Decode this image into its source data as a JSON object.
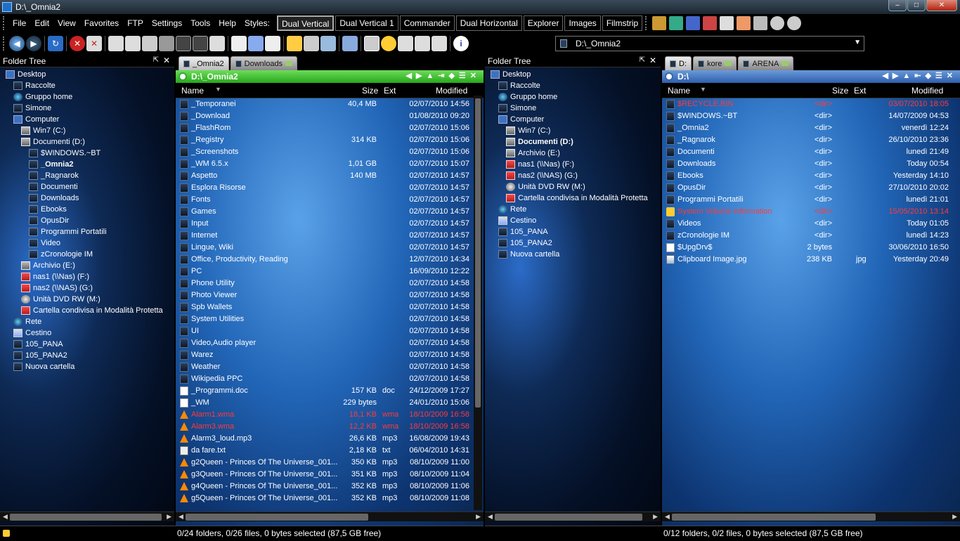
{
  "window": {
    "title": "D:\\_Omnia2",
    "min": "–",
    "max": "□",
    "close": "✕"
  },
  "menu": [
    "File",
    "Edit",
    "View",
    "Favorites",
    "FTP",
    "Settings",
    "Tools",
    "Help",
    "Styles:"
  ],
  "styles": [
    {
      "label": "Dual Vertical",
      "active": true
    },
    {
      "label": "Dual Vertical 1",
      "active": false
    },
    {
      "label": "Commander",
      "active": false
    },
    {
      "label": "Dual Horizontal",
      "active": false
    },
    {
      "label": "Explorer",
      "active": false
    },
    {
      "label": "Images",
      "active": false
    },
    {
      "label": "Filmstrip",
      "active": false
    }
  ],
  "colors": {
    "red_file": "#ff3a3a",
    "path_green": "#27a81c",
    "path_blue": "#2e5fae"
  },
  "address": {
    "value": "D:\\_Omnia2"
  },
  "left_tree": {
    "title": "Folder Tree",
    "nodes": [
      {
        "label": "Desktop",
        "indent": 0,
        "icon": "desktop-icon"
      },
      {
        "label": "Raccolte",
        "indent": 1,
        "icon": "folder-icon"
      },
      {
        "label": "Gruppo home",
        "indent": 1,
        "icon": "network-icon"
      },
      {
        "label": "Simone",
        "indent": 1,
        "icon": "folder-icon"
      },
      {
        "label": "Computer",
        "indent": 1,
        "icon": "computer-icon"
      },
      {
        "label": "Win7 (C:)",
        "indent": 2,
        "icon": "drive-icon"
      },
      {
        "label": "Documenti (D:)",
        "indent": 2,
        "icon": "drive-icon"
      },
      {
        "label": "$WINDOWS.~BT",
        "indent": 3,
        "icon": "folder-icon"
      },
      {
        "label": "_Omnia2",
        "indent": 3,
        "icon": "folder-icon",
        "selected": true
      },
      {
        "label": "_Ragnarok",
        "indent": 3,
        "icon": "folder-icon"
      },
      {
        "label": "Documenti",
        "indent": 3,
        "icon": "folder-icon"
      },
      {
        "label": "Downloads",
        "indent": 3,
        "icon": "folder-icon"
      },
      {
        "label": "Ebooks",
        "indent": 3,
        "icon": "folder-icon"
      },
      {
        "label": "OpusDir",
        "indent": 3,
        "icon": "folder-icon"
      },
      {
        "label": "Programmi Portatili",
        "indent": 3,
        "icon": "folder-icon"
      },
      {
        "label": "Video",
        "indent": 3,
        "icon": "folder-icon"
      },
      {
        "label": "zCronologie IM",
        "indent": 3,
        "icon": "folder-icon"
      },
      {
        "label": "Archivio (E:)",
        "indent": 2,
        "icon": "drive-icon"
      },
      {
        "label": "nas1 (\\\\Nas) (F:)",
        "indent": 2,
        "icon": "network-drive-icon"
      },
      {
        "label": "nas2 (\\\\NAS) (G:)",
        "indent": 2,
        "icon": "network-drive-icon"
      },
      {
        "label": "Unità DVD RW (M:)",
        "indent": 2,
        "icon": "dvd-icon"
      },
      {
        "label": "Cartella condivisa in Modalità Protetta",
        "indent": 2,
        "icon": "shared-folder-icon"
      },
      {
        "label": "Rete",
        "indent": 1,
        "icon": "network-icon"
      },
      {
        "label": "Cestino",
        "indent": 1,
        "icon": "recycle-bin-icon"
      },
      {
        "label": "105_PANA",
        "indent": 1,
        "icon": "folder-icon"
      },
      {
        "label": "105_PANA2",
        "indent": 1,
        "icon": "folder-icon"
      },
      {
        "label": "Nuova cartella",
        "indent": 1,
        "icon": "folder-icon"
      }
    ]
  },
  "right_tree": {
    "title": "Folder Tree",
    "nodes": [
      {
        "label": "Desktop",
        "indent": 0,
        "icon": "desktop-icon"
      },
      {
        "label": "Raccolte",
        "indent": 1,
        "icon": "folder-icon"
      },
      {
        "label": "Gruppo home",
        "indent": 1,
        "icon": "network-icon"
      },
      {
        "label": "Simone",
        "indent": 1,
        "icon": "folder-icon"
      },
      {
        "label": "Computer",
        "indent": 1,
        "icon": "computer-icon"
      },
      {
        "label": "Win7 (C:)",
        "indent": 2,
        "icon": "drive-icon"
      },
      {
        "label": "Documenti (D:)",
        "indent": 2,
        "icon": "drive-icon",
        "selected": true
      },
      {
        "label": "Archivio (E:)",
        "indent": 2,
        "icon": "drive-icon"
      },
      {
        "label": "nas1 (\\\\Nas) (F:)",
        "indent": 2,
        "icon": "network-drive-icon"
      },
      {
        "label": "nas2 (\\\\NAS) (G:)",
        "indent": 2,
        "icon": "network-drive-icon"
      },
      {
        "label": "Unità DVD RW (M:)",
        "indent": 2,
        "icon": "dvd-icon"
      },
      {
        "label": "Cartella condivisa in Modalità Protetta",
        "indent": 2,
        "icon": "shared-folder-icon"
      },
      {
        "label": "Rete",
        "indent": 1,
        "icon": "network-icon"
      },
      {
        "label": "Cestino",
        "indent": 1,
        "icon": "recycle-bin-icon"
      },
      {
        "label": "105_PANA",
        "indent": 1,
        "icon": "folder-icon"
      },
      {
        "label": "105_PANA2",
        "indent": 1,
        "icon": "folder-icon"
      },
      {
        "label": "Nuova cartella",
        "indent": 1,
        "icon": "folder-icon"
      }
    ]
  },
  "left_files": {
    "tabs": [
      {
        "label": "_Omnia2",
        "active": true
      },
      {
        "label": "Downloads",
        "active": false
      }
    ],
    "path": "D:\\_Omnia2",
    "columns": {
      "name": "Name",
      "size": "Size",
      "ext": "Ext",
      "modified": "Modified"
    },
    "rows": [
      {
        "name": "_Temporanei",
        "size": "40,4 MB",
        "ext": "",
        "modified": "02/07/2010 14:56",
        "type": "folder"
      },
      {
        "name": "_Download",
        "size": "",
        "ext": "",
        "modified": "01/08/2010 09:20",
        "type": "folder"
      },
      {
        "name": "_FlashRom",
        "size": "",
        "ext": "",
        "modified": "02/07/2010 15:06",
        "type": "folder"
      },
      {
        "name": "_Registry",
        "size": "314 KB",
        "ext": "",
        "modified": "02/07/2010 15:06",
        "type": "folder"
      },
      {
        "name": "_Screenshots",
        "size": "",
        "ext": "",
        "modified": "02/07/2010 15:06",
        "type": "folder"
      },
      {
        "name": "_WM 6.5.x",
        "size": "1,01 GB",
        "ext": "",
        "modified": "02/07/2010 15:07",
        "type": "folder"
      },
      {
        "name": "Aspetto",
        "size": "140 MB",
        "ext": "",
        "modified": "02/07/2010 14:57",
        "type": "folder"
      },
      {
        "name": "Esplora Risorse",
        "size": "",
        "ext": "",
        "modified": "02/07/2010 14:57",
        "type": "folder"
      },
      {
        "name": "Fonts",
        "size": "",
        "ext": "",
        "modified": "02/07/2010 14:57",
        "type": "folder"
      },
      {
        "name": "Games",
        "size": "",
        "ext": "",
        "modified": "02/07/2010 14:57",
        "type": "folder"
      },
      {
        "name": "Input",
        "size": "",
        "ext": "",
        "modified": "02/07/2010 14:57",
        "type": "folder"
      },
      {
        "name": "Internet",
        "size": "",
        "ext": "",
        "modified": "02/07/2010 14:57",
        "type": "folder"
      },
      {
        "name": "Lingue, Wiki",
        "size": "",
        "ext": "",
        "modified": "02/07/2010 14:57",
        "type": "folder"
      },
      {
        "name": "Office, Productivity, Reading",
        "size": "",
        "ext": "",
        "modified": "12/07/2010 14:34",
        "type": "folder"
      },
      {
        "name": "PC",
        "size": "",
        "ext": "",
        "modified": "16/09/2010 12:22",
        "type": "folder"
      },
      {
        "name": "Phone Utility",
        "size": "",
        "ext": "",
        "modified": "02/07/2010 14:58",
        "type": "folder"
      },
      {
        "name": "Photo Viewer",
        "size": "",
        "ext": "",
        "modified": "02/07/2010 14:58",
        "type": "folder"
      },
      {
        "name": "Spb Wallets",
        "size": "",
        "ext": "",
        "modified": "02/07/2010 14:58",
        "type": "folder"
      },
      {
        "name": "System Utilities",
        "size": "",
        "ext": "",
        "modified": "02/07/2010 14:58",
        "type": "folder"
      },
      {
        "name": "UI",
        "size": "",
        "ext": "",
        "modified": "02/07/2010 14:58",
        "type": "folder"
      },
      {
        "name": "Video,Audio player",
        "size": "",
        "ext": "",
        "modified": "02/07/2010 14:58",
        "type": "folder"
      },
      {
        "name": "Warez",
        "size": "",
        "ext": "",
        "modified": "02/07/2010 14:58",
        "type": "folder"
      },
      {
        "name": "Weather",
        "size": "",
        "ext": "",
        "modified": "02/07/2010 14:58",
        "type": "folder"
      },
      {
        "name": "Wikipedia PPC",
        "size": "",
        "ext": "",
        "modified": "02/07/2010 14:58",
        "type": "folder"
      },
      {
        "name": "_Programmi.doc",
        "size": "157 KB",
        "ext": "doc",
        "modified": "24/12/2009 17:27",
        "type": "file"
      },
      {
        "name": "_WM",
        "size": "229 bytes",
        "ext": "",
        "modified": "24/01/2010 15:06",
        "type": "file"
      },
      {
        "name": "Alarm1.wma",
        "size": "18,1 KB",
        "ext": "wma",
        "modified": "18/10/2009 16:58",
        "type": "cone",
        "red": true
      },
      {
        "name": "Alarm3.wma",
        "size": "12,2 KB",
        "ext": "wma",
        "modified": "18/10/2009 16:58",
        "type": "cone",
        "red": true
      },
      {
        "name": "Alarm3_loud.mp3",
        "size": "26,6 KB",
        "ext": "mp3",
        "modified": "16/08/2009 19:43",
        "type": "cone"
      },
      {
        "name": "da fare.txt",
        "size": "2,18 KB",
        "ext": "txt",
        "modified": "06/04/2010 14:31",
        "type": "txt"
      },
      {
        "name": "g2Queen - Princes Of The Universe_001...",
        "size": "350 KB",
        "ext": "mp3",
        "modified": "08/10/2009 11:00",
        "type": "cone"
      },
      {
        "name": "g3Queen - Princes Of The Universe_001...",
        "size": "351 KB",
        "ext": "mp3",
        "modified": "08/10/2009 11:04",
        "type": "cone"
      },
      {
        "name": "g4Queen - Princes Of The Universe_001...",
        "size": "352 KB",
        "ext": "mp3",
        "modified": "08/10/2009 11:06",
        "type": "cone"
      },
      {
        "name": "g5Queen - Princes Of The Universe_001...",
        "size": "352 KB",
        "ext": "mp3",
        "modified": "08/10/2009 11:08",
        "type": "cone"
      }
    ]
  },
  "right_files": {
    "tabs": [
      {
        "label": "D:",
        "active": true
      },
      {
        "label": "kore",
        "active": false
      },
      {
        "label": "ARENA",
        "active": false
      }
    ],
    "path": "D:\\",
    "columns": {
      "name": "Name",
      "size": "Size",
      "ext": "Ext",
      "modified": "Modified"
    },
    "rows": [
      {
        "name": "$RECYCLE.BIN",
        "size": "<dir>",
        "ext": "",
        "modified": "03/07/2010 18:05",
        "type": "folder",
        "red": true
      },
      {
        "name": "$WINDOWS.~BT",
        "size": "<dir>",
        "ext": "",
        "modified": "14/07/2009 04:53",
        "type": "folder"
      },
      {
        "name": "_Omnia2",
        "size": "<dir>",
        "ext": "",
        "modified": "venerdì 12:24",
        "type": "folder"
      },
      {
        "name": "_Ragnarok",
        "size": "<dir>",
        "ext": "",
        "modified": "26/10/2010 23:36",
        "type": "folder"
      },
      {
        "name": "Documenti",
        "size": "<dir>",
        "ext": "",
        "modified": "lunedì 21:49",
        "type": "folder"
      },
      {
        "name": "Downloads",
        "size": "<dir>",
        "ext": "",
        "modified": "Today 00:54",
        "type": "folder"
      },
      {
        "name": "Ebooks",
        "size": "<dir>",
        "ext": "",
        "modified": "Yesterday 14:10",
        "type": "folder"
      },
      {
        "name": "OpusDir",
        "size": "<dir>",
        "ext": "",
        "modified": "27/10/2010 20:02",
        "type": "folder"
      },
      {
        "name": "Programmi Portatili",
        "size": "<dir>",
        "ext": "",
        "modified": "lunedì 21:01",
        "type": "folder"
      },
      {
        "name": "System Volume Information",
        "size": "<dir>",
        "ext": "",
        "modified": "15/05/2010 13:14",
        "type": "lock",
        "red": true
      },
      {
        "name": "Videos",
        "size": "<dir>",
        "ext": "",
        "modified": "Today 01:05",
        "type": "folder"
      },
      {
        "name": "zCronologie IM",
        "size": "<dir>",
        "ext": "",
        "modified": "lunedì 14:23",
        "type": "folder"
      },
      {
        "name": "$UpgDrv$",
        "size": "2 bytes",
        "ext": "",
        "modified": "30/06/2010 16:50",
        "type": "file"
      },
      {
        "name": "Clipboard Image.jpg",
        "size": "238 KB",
        "ext": "jpg",
        "modified": "Yesterday 20:49",
        "type": "img"
      }
    ]
  },
  "status": {
    "left": "0/24 folders, 0/26 files, 0 bytes selected (87,5 GB free)",
    "right": "0/12 folders, 0/2 files, 0 bytes selected (87,5 GB free)"
  }
}
